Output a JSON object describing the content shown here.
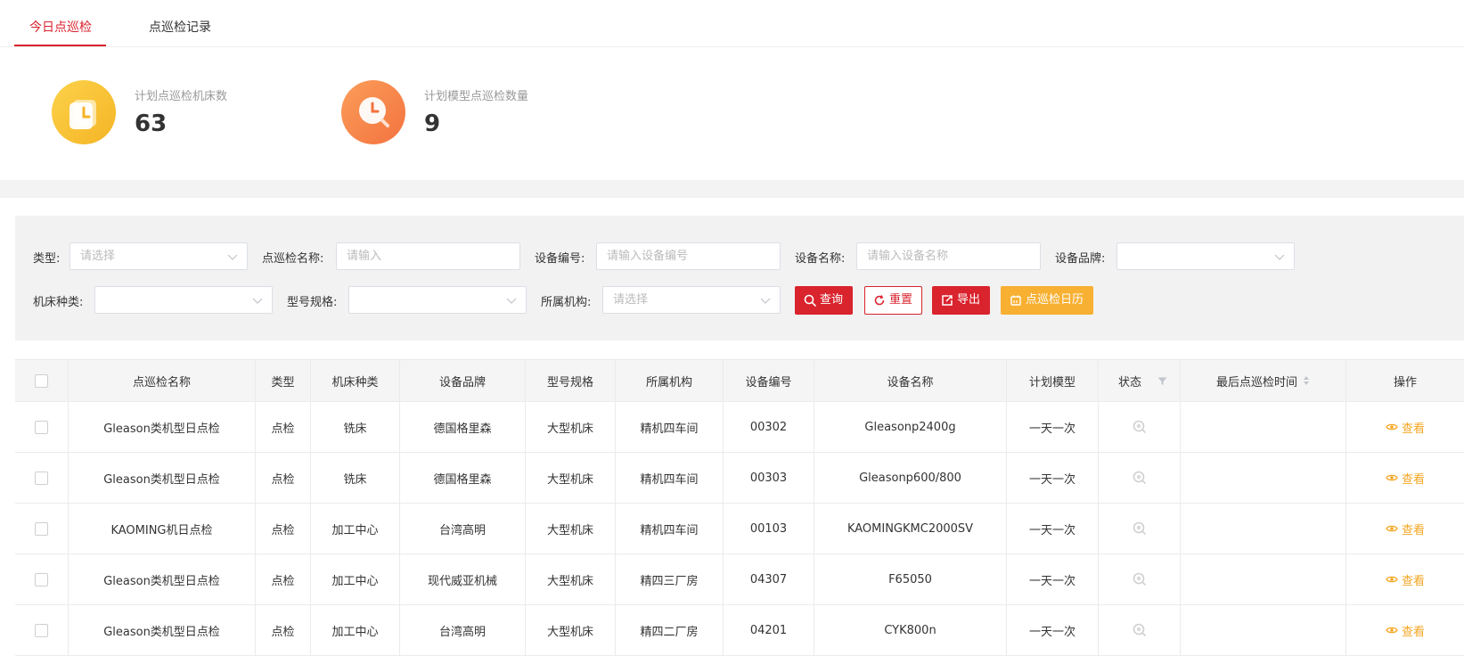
{
  "tabs": [
    {
      "label": "今日点巡检",
      "active": true
    },
    {
      "label": "点巡检记录",
      "active": false
    }
  ],
  "stats": [
    {
      "label": "计划点巡检机床数",
      "value": "63",
      "icon": "clock-icon",
      "color": "#f8c135"
    },
    {
      "label": "计划模型点巡检数量",
      "value": "9",
      "icon": "clock-search-icon",
      "color": "#f7874d"
    }
  ],
  "filters": {
    "type": {
      "label": "类型:",
      "placeholder": "请选择"
    },
    "inspection_name": {
      "label": "点巡检名称:",
      "placeholder": "请输入"
    },
    "device_no": {
      "label": "设备编号:",
      "placeholder": "请输入设备编号"
    },
    "device_name": {
      "label": "设备名称:",
      "placeholder": "请输入设备名称"
    },
    "device_brand": {
      "label": "设备品牌:",
      "placeholder": ""
    },
    "machine_type": {
      "label": "机床种类:",
      "placeholder": ""
    },
    "model_spec": {
      "label": "型号规格:",
      "placeholder": ""
    },
    "org": {
      "label": "所属机构:",
      "placeholder": "请选择"
    }
  },
  "buttons": {
    "query": "查询",
    "reset": "重置",
    "export": "导出",
    "calendar": "点巡检日历"
  },
  "table": {
    "columns": [
      "点巡检名称",
      "类型",
      "机床种类",
      "设备品牌",
      "型号规格",
      "所属机构",
      "设备编号",
      "设备名称",
      "计划模型",
      "状态",
      "最后点巡检时间",
      "操作"
    ],
    "view_label": "查看",
    "rows": [
      {
        "name": "Gleason类机型日点检",
        "type": "点检",
        "machine_type": "铣床",
        "brand": "德国格里森",
        "spec": "大型机床",
        "org": "精机四车间",
        "no": "00302",
        "device_name": "Gleasonp2400g",
        "plan": "一天一次",
        "last_time": ""
      },
      {
        "name": "Gleason类机型日点检",
        "type": "点检",
        "machine_type": "铣床",
        "brand": "德国格里森",
        "spec": "大型机床",
        "org": "精机四车间",
        "no": "00303",
        "device_name": "Gleasonp600/800",
        "plan": "一天一次",
        "last_time": ""
      },
      {
        "name": "KAOMING机日点检",
        "type": "点检",
        "machine_type": "加工中心",
        "brand": "台湾高明",
        "spec": "大型机床",
        "org": "精机四车间",
        "no": "00103",
        "device_name": "KAOMINGKMC2000SV",
        "plan": "一天一次",
        "last_time": ""
      },
      {
        "name": "Gleason类机型日点检",
        "type": "点检",
        "machine_type": "加工中心",
        "brand": "现代威亚机械",
        "spec": "大型机床",
        "org": "精四三厂房",
        "no": "04307",
        "device_name": "F65050",
        "plan": "一天一次",
        "last_time": ""
      },
      {
        "name": "Gleason类机型日点检",
        "type": "点检",
        "machine_type": "加工中心",
        "brand": "台湾高明",
        "spec": "大型机床",
        "org": "精四二厂房",
        "no": "04201",
        "device_name": "CYK800n",
        "plan": "一天一次",
        "last_time": ""
      }
    ]
  }
}
